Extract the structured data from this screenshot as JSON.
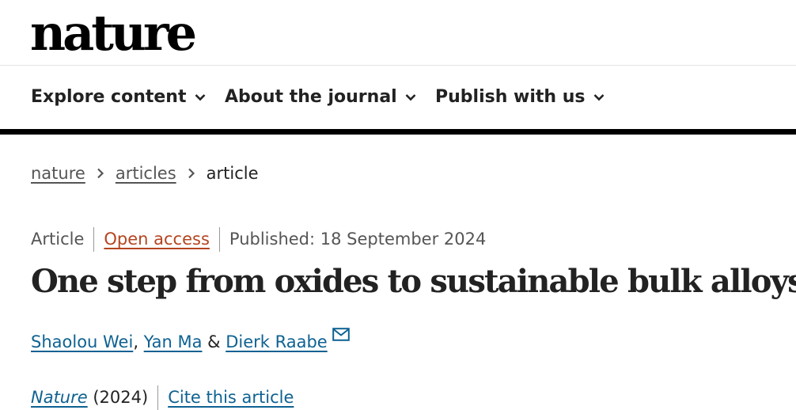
{
  "header": {
    "logo_text": "nature"
  },
  "nav": {
    "items": [
      {
        "label": "Explore content",
        "icon": "chevron-down-icon"
      },
      {
        "label": "About the journal",
        "icon": "chevron-down-icon"
      },
      {
        "label": "Publish with us",
        "icon": "chevron-down-icon"
      }
    ]
  },
  "breadcrumb": {
    "items": [
      "nature",
      "articles"
    ],
    "current": "article"
  },
  "article": {
    "type": "Article",
    "access": "Open access",
    "published": "Published: 18 September 2024",
    "title": "One step from oxides to sustainable bulk alloys",
    "authors": [
      "Shaolou Wei",
      "Yan Ma",
      "Dierk Raabe"
    ],
    "author_sep_1": ", ",
    "author_sep_2": " & ",
    "journal": "Nature",
    "year": " (2024)",
    "cite_label": "Cite this article"
  },
  "colors": {
    "link": "#0e6292",
    "open_access": "#b5441f",
    "text": "#222222",
    "muted": "#555555"
  }
}
